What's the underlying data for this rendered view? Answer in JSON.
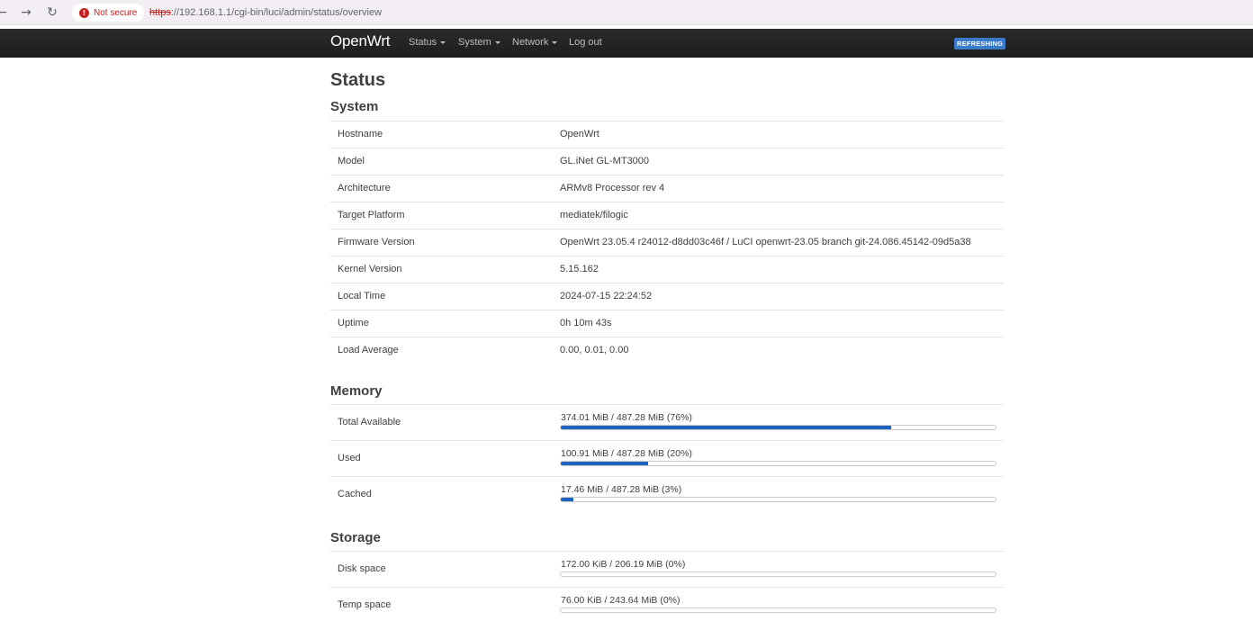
{
  "browser": {
    "security_label": "Not secure",
    "url_scheme": "https",
    "url_rest": "://192.168.1.1/cgi-bin/luci/admin/status/overview"
  },
  "header": {
    "brand": "OpenWrt",
    "menu": [
      "Status",
      "System",
      "Network",
      "Log out"
    ],
    "badge": "REFRESHING"
  },
  "page_title": "Status",
  "system": {
    "heading": "System",
    "rows": [
      {
        "key": "Hostname",
        "value": "OpenWrt"
      },
      {
        "key": "Model",
        "value": "GL.iNet GL-MT3000"
      },
      {
        "key": "Architecture",
        "value": "ARMv8 Processor rev 4"
      },
      {
        "key": "Target Platform",
        "value": "mediatek/filogic"
      },
      {
        "key": "Firmware Version",
        "value": "OpenWrt 23.05.4 r24012-d8dd03c46f / LuCI openwrt-23.05 branch git-24.086.45142-09d5a38"
      },
      {
        "key": "Kernel Version",
        "value": "5.15.162"
      },
      {
        "key": "Local Time",
        "value": "2024-07-15 22:24:52"
      },
      {
        "key": "Uptime",
        "value": "0h 10m 43s"
      },
      {
        "key": "Load Average",
        "value": "0.00, 0.01, 0.00"
      }
    ]
  },
  "memory": {
    "heading": "Memory",
    "rows": [
      {
        "key": "Total Available",
        "text": "374.01 MiB / 487.28 MiB (76%)",
        "percent": 76
      },
      {
        "key": "Used",
        "text": "100.91 MiB / 487.28 MiB (20%)",
        "percent": 20
      },
      {
        "key": "Cached",
        "text": "17.46 MiB / 487.28 MiB (3%)",
        "percent": 3
      }
    ]
  },
  "storage": {
    "heading": "Storage",
    "rows": [
      {
        "key": "Disk space",
        "text": "172.00 KiB / 206.19 MiB (0%)",
        "percent": 0
      },
      {
        "key": "Temp space",
        "text": "76.00 KiB / 243.64 MiB (0%)",
        "percent": 0
      }
    ]
  },
  "colors": {
    "header_bg": "#222222",
    "accent": "#1e64c0",
    "badge": "#3a7bc8"
  }
}
